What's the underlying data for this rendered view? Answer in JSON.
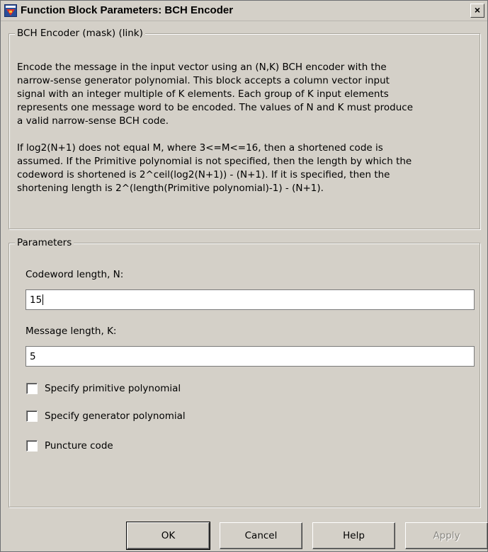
{
  "window": {
    "title": "Function Block Parameters: BCH Encoder",
    "close_label": "×"
  },
  "description": {
    "legend": "BCH Encoder (mask) (link)",
    "paragraph1": [
      "Encode the message in the input vector using an (N,K) BCH encoder with the",
      "narrow-sense generator polynomial.  This block accepts a column vector input",
      "signal with an integer multiple of K elements.  Each group of K input elements",
      "represents one message word to be encoded.  The values of N and K must produce",
      "a valid narrow-sense BCH code."
    ],
    "paragraph2": [
      "If log2(N+1) does not equal M, where 3<=M<=16, then a shortened code is",
      "assumed.  If the Primitive polynomial is not specified, then the length by which the",
      "codeword is shortened is 2^ceil(log2(N+1)) - (N+1).  If it is specified, then the",
      "shortening length is 2^(length(Primitive polynomial)-1) - (N+1)."
    ]
  },
  "parameters": {
    "legend": "Parameters",
    "codeword_label": "Codeword length, N:",
    "codeword_value": "15",
    "message_label": "Message length, K:",
    "message_value": "5",
    "checkboxes": [
      {
        "label": "Specify primitive polynomial",
        "checked": false
      },
      {
        "label": "Specify generator polynomial",
        "checked": false
      },
      {
        "label": "Puncture code",
        "checked": false
      }
    ]
  },
  "buttons": {
    "ok": "OK",
    "cancel": "Cancel",
    "help": "Help",
    "apply": "Apply"
  }
}
